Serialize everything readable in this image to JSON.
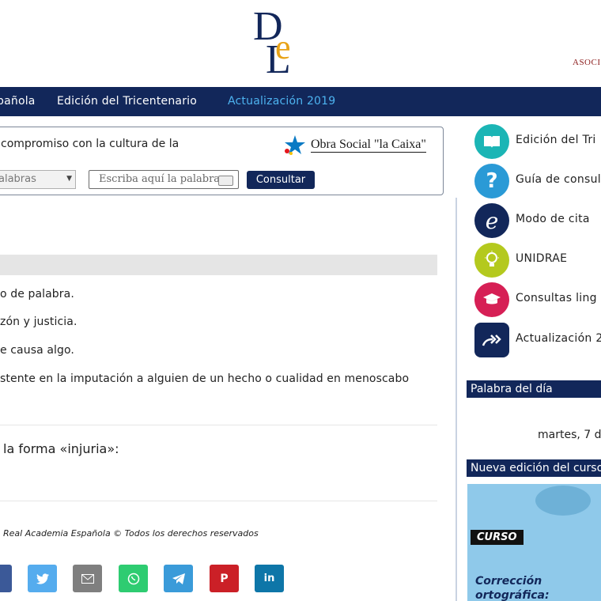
{
  "header": {
    "logo_text": "DLE",
    "assoc_text": "ASOCI"
  },
  "nav": {
    "items": [
      {
        "label": "pañola",
        "active": false
      },
      {
        "label": "Edición del Tricentenario",
        "active": false
      },
      {
        "label": "Actualización 2019",
        "active": true
      }
    ]
  },
  "search": {
    "intro_text": "compromiso con la cultura de la",
    "sponsor": "Obra Social \"la Caixa\"",
    "select_value": "alabras",
    "input_placeholder": "Escriba aquí la palabra",
    "button_label": "Consultar"
  },
  "definitions": [
    "o de palabra.",
    "zón y justicia.",
    "e causa algo.",
    "stente en la imputación a alguien de un hecho o cualidad en menoscabo"
  ],
  "forma_text": "la forma «injuria»:",
  "copyright": "Real Academia Española © Todos los derechos reservados",
  "share_icons": [
    {
      "icon": "facebook-icon",
      "color": "#3b5998"
    },
    {
      "icon": "twitter-icon",
      "color": "#55acee"
    },
    {
      "icon": "email-icon",
      "color": "#7f7f7f"
    },
    {
      "icon": "whatsapp-icon",
      "color": "#2ecc71"
    },
    {
      "icon": "telegram-icon",
      "color": "#3a9bd9"
    },
    {
      "icon": "pinterest-icon",
      "color": "#cb2027"
    },
    {
      "icon": "linkedin-icon",
      "color": "#0e76a8"
    }
  ],
  "sidebar": {
    "items": [
      {
        "label": "Edición del Tri",
        "icon": "book-icon",
        "color": "#1bb5b5"
      },
      {
        "label": "Guía de consul",
        "icon": "question-icon",
        "color": "#2a9ad6"
      },
      {
        "label": "Modo de cita",
        "icon": "e-letter-icon",
        "color": "#12275a"
      },
      {
        "label": "UNIDRAE",
        "icon": "lightbulb-icon",
        "color": "#b4c91e"
      },
      {
        "label": "Consultas ling",
        "icon": "graduation-cap-icon",
        "color": "#d61f55"
      },
      {
        "label": "Actualización 2",
        "icon": "double-arrow-icon",
        "color": "#12275a"
      }
    ],
    "word_of_day_title": "Palabra del día",
    "word_of_day_date": "martes, 7 d",
    "course_header": "Nueva edición del curso",
    "course_tag": "CURSO",
    "course_title_line1": "Corrección",
    "course_title_line2": "ortográfica:"
  }
}
